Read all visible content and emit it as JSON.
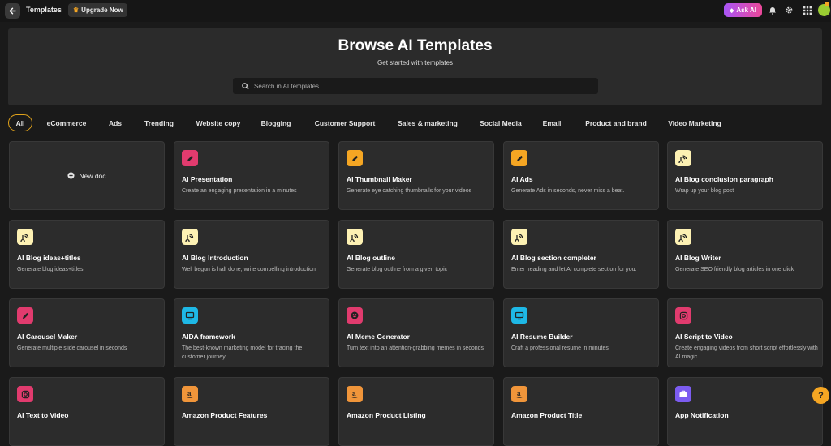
{
  "topbar": {
    "title": "Templates",
    "upgrade_label": "Upgrade Now",
    "ask_ai_label": "Ask AI",
    "icons": [
      "back-arrow-icon",
      "crown-icon",
      "bell-icon",
      "gear-icon",
      "apps-grid-icon"
    ]
  },
  "hero": {
    "title": "Browse AI Templates",
    "subtitle": "Get started with templates",
    "search_placeholder": "Search in AI templates"
  },
  "tabs": [
    "All",
    "eCommerce",
    "Ads",
    "Trending",
    "Website copy",
    "Blogging",
    "Customer Support",
    "Sales & marketing",
    "Social Media",
    "Email",
    "Product and brand",
    "Video Marketing"
  ],
  "active_tab": "All",
  "new_doc_label": "New doc",
  "cards": [
    {
      "title": "AI Presentation",
      "desc": "Create an engaging presentation in a minutes",
      "icon": "pencil-icon",
      "color": "#e13b6e"
    },
    {
      "title": "AI Thumbnail Maker",
      "desc": "Generate eye catching thumbnails for your videos",
      "icon": "pencil-icon",
      "color": "#f5a623"
    },
    {
      "title": "AI Ads",
      "desc": "Generate Ads in seconds, never miss a beat.",
      "icon": "pencil-icon",
      "color": "#f5a623"
    },
    {
      "title": "AI Blog conclusion paragraph",
      "desc": "Wrap up your blog post",
      "icon": "blog-icon",
      "color": "#fdf1b3"
    },
    {
      "title": "AI Blog ideas+titles",
      "desc": "Generate blog ideas+titles",
      "icon": "blog-icon",
      "color": "#fdf1b3"
    },
    {
      "title": "AI Blog Introduction",
      "desc": "Well begun is half done, write compelling introduction",
      "icon": "blog-icon",
      "color": "#fdf1b3"
    },
    {
      "title": "AI Blog outline",
      "desc": "Generate blog outline from a given topic",
      "icon": "blog-icon",
      "color": "#fdf1b3"
    },
    {
      "title": "AI Blog section completer",
      "desc": "Enter heading and let AI complete section for you.",
      "icon": "blog-icon",
      "color": "#fdf1b3"
    },
    {
      "title": "AI Blog Writer",
      "desc": "Generate SEO friendly blog articles in one click",
      "icon": "blog-icon",
      "color": "#fdf1b3"
    },
    {
      "title": "AI Carousel Maker",
      "desc": "Generate multiple slide carousel in seconds",
      "icon": "pencil-icon",
      "color": "#e13b6e"
    },
    {
      "title": "AIDA framework",
      "desc": "The best-known marketing model for tracing the customer journey.",
      "icon": "monitor-icon",
      "color": "#1eb8e6"
    },
    {
      "title": "AI Meme Generator",
      "desc": "Turn text into an attention-grabbing memes in seconds",
      "icon": "smile-icon",
      "color": "#e13b6e"
    },
    {
      "title": "AI Resume Builder",
      "desc": "Craft a professional resume in minutes",
      "icon": "monitor-icon",
      "color": "#1eb8e6"
    },
    {
      "title": "AI Script to Video",
      "desc": "Create engaging videos from short script effortlessly with AI magic",
      "icon": "instagram-icon",
      "color": "#e13b6e"
    },
    {
      "title": "AI Text to Video",
      "desc": "",
      "icon": "instagram-icon",
      "color": "#e13b6e"
    },
    {
      "title": "Amazon Product Features",
      "desc": "",
      "icon": "amazon-icon",
      "color": "#f0953a"
    },
    {
      "title": "Amazon Product Listing",
      "desc": "",
      "icon": "amazon-icon",
      "color": "#f0953a"
    },
    {
      "title": "Amazon Product Title",
      "desc": "",
      "icon": "amazon-icon",
      "color": "#f0953a"
    },
    {
      "title": "App Notification",
      "desc": "",
      "icon": "briefcase-icon",
      "color": "#7c5cf0"
    }
  ],
  "help_label": "?"
}
